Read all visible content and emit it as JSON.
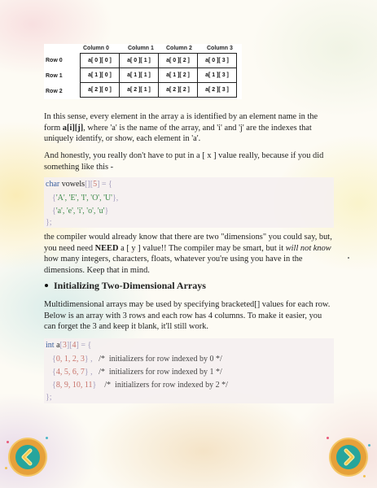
{
  "array_table": {
    "column_headers": [
      "Column  0",
      "Column  1",
      "Column  2",
      "Column  3"
    ],
    "row_headers": [
      "Row  0",
      "Row  1",
      "Row  2"
    ],
    "cells": [
      [
        "a[ 0 ][ 0 ]",
        "a[ 0 ][ 1 ]",
        "a[ 0 ][ 2 ]",
        "a[ 0 ][ 3 ]"
      ],
      [
        "a[ 1 ][ 0 ]",
        "a[ 1 ][ 1 ]",
        "a[ 1 ][ 2 ]",
        "a[ 1 ][ 3 ]"
      ],
      [
        "a[ 2 ][ 0 ]",
        "a[ 2 ][ 1 ]",
        "a[ 2 ][ 2 ]",
        "a[ 2 ][ 3 ]"
      ]
    ]
  },
  "para1": {
    "part1": "In this sense, every element in the array a is identified by an element name in the form ",
    "bold": "a[i][j]",
    "part2": ", where 'a' is the name of the array, and 'i' and 'j' are the indexes that uniquely identify, or show, each element in 'a'."
  },
  "para2": "And honestly, you really don't have to put in a [ x ] value really, because if you did something like this -",
  "code1": {
    "type": "char",
    "name": "vowels",
    "brackets_1": "[][",
    "size": "5",
    "brackets_2": "] = {",
    "row1_open": "{",
    "row1_values": "'A', 'E', 'I', 'O', 'U'",
    "row1_close": "},",
    "row2_open": "{",
    "row2_values": "'a', 'e', 'i', 'o', 'u'",
    "row2_close": "}",
    "close": "};"
  },
  "para3": {
    "part1": "the compiler would already know that there are two \"dimensions\" you could say, but, you need need ",
    "bold": "NEED",
    "part2": " a [ y ] value!! The compiler may be smart, but it ",
    "italic": "will not know",
    "part3": " how many integers, characters, floats, whatever you're using you have in the dimensions. Keep that in mind."
  },
  "heading": "Initializing Two-Dimensional Arrays",
  "para4": "Multidimensional arrays may be used by specifying bracketed[] values for each row. Below is an array with 3 rows and each row has 4 columns. To make it easier, you can forget the 3 and keep it blank, it'll still work.",
  "code2": {
    "type": "int",
    "name": "a",
    "b1": "[",
    "d1": "3",
    "b2": "][",
    "d2": "4",
    "b3": "] = {",
    "rows": [
      {
        "open": "{",
        "values": "0, 1, 2, 3",
        "close": "} ,",
        "comment": "/*  initializers for row indexed by 0 */"
      },
      {
        "open": "{",
        "values": "4, 5, 6, 7",
        "close": "} ,",
        "comment": "/*  initializers for row indexed by 1 */"
      },
      {
        "open": "{",
        "values": "8, 9, 10, 11",
        "close": "}",
        "comment": "/*  initializers for row indexed by 2 */"
      }
    ],
    "close": "};"
  },
  "colors": {
    "nav_ring": "#e6a13a",
    "nav_fill": "#27a59c",
    "keyword": "#3b5f9e",
    "number": "#c8736a",
    "string": "#3c8a4a"
  },
  "icons": {
    "prev": "chevron-left-icon",
    "next": "chevron-right-icon"
  }
}
